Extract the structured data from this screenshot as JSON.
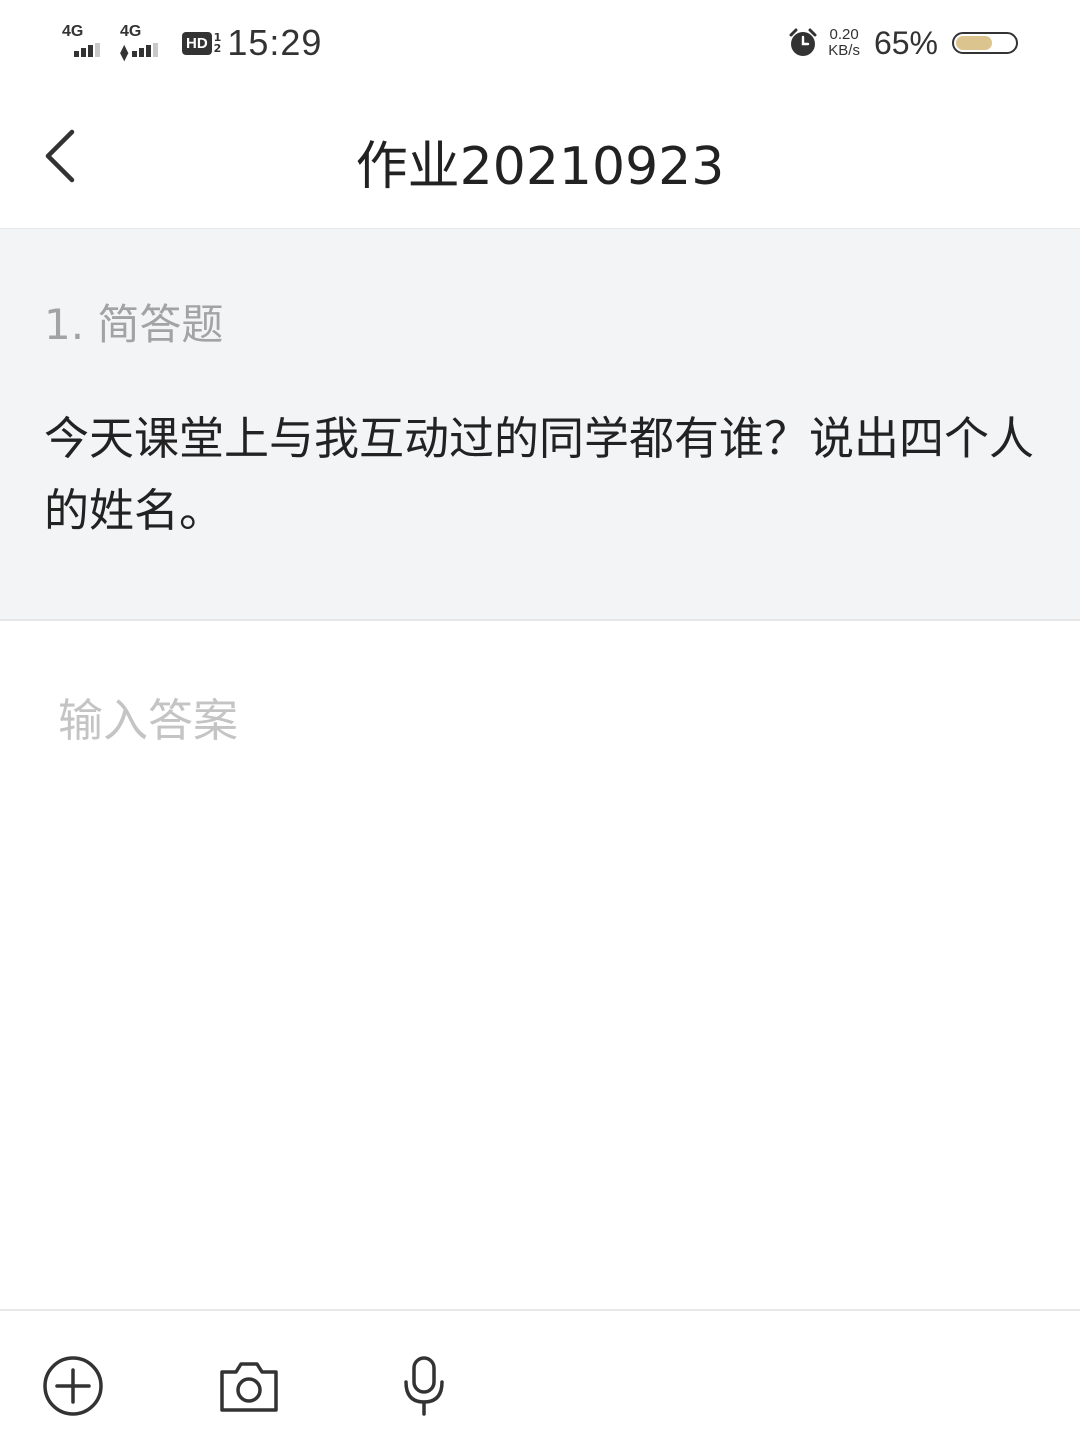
{
  "status_bar": {
    "sim1_network": "4G",
    "sim2_network": "4G",
    "hd_label": "HD",
    "hd_sub_top": "1",
    "hd_sub_bottom": "2",
    "time": "15:29",
    "net_speed_value": "0.20",
    "net_speed_unit": "KB/s",
    "battery_percent_text": "65%",
    "battery_level": 0.65,
    "battery_color": "#dcc48f",
    "icons": [
      "signal-icon",
      "signal-icon",
      "hd-voice-icon",
      "alarm-icon",
      "battery-icon"
    ]
  },
  "nav": {
    "back_icon": "chevron-left-icon",
    "title": "作业20210923"
  },
  "question": {
    "type_label": "1. 简答题",
    "text": "今天课堂上与我互动过的同学都有谁？说出四个人的姓名。"
  },
  "answer": {
    "value": "",
    "placeholder": "输入答案"
  },
  "toolbar": {
    "items": [
      {
        "icon": "add-circle-icon"
      },
      {
        "icon": "camera-icon"
      },
      {
        "icon": "microphone-icon"
      }
    ]
  },
  "colors": {
    "question_bg": "#f3f4f6",
    "placeholder": "#c4c4c4",
    "type_label": "#a3a3a3"
  }
}
